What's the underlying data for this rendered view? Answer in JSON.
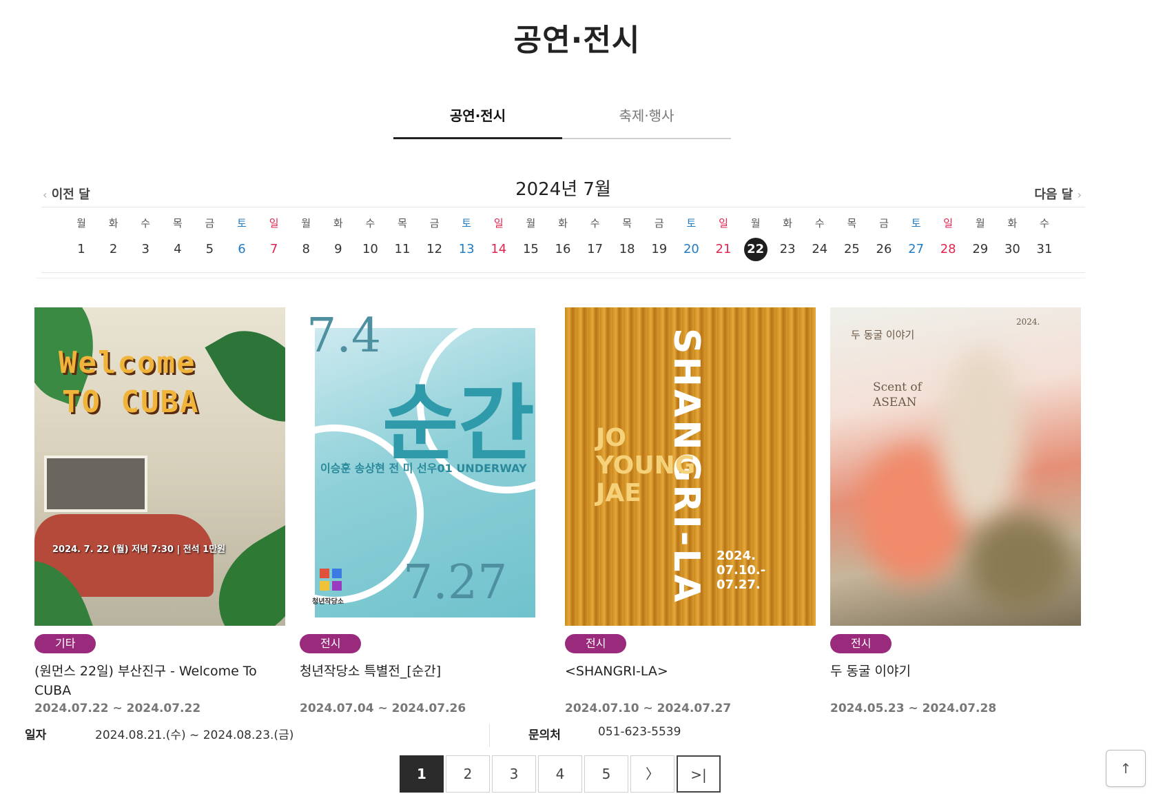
{
  "page": {
    "title": "공연·전시"
  },
  "tabs": [
    {
      "label": "공연·전시",
      "active": true
    },
    {
      "label": "축제·행사",
      "active": false
    }
  ],
  "calendar": {
    "prev_label": "이전 달",
    "next_label": "다음 달",
    "month_label": "2024년 7월",
    "days": [
      {
        "dow": "월",
        "num": "1",
        "type": "weekday"
      },
      {
        "dow": "화",
        "num": "2",
        "type": "weekday"
      },
      {
        "dow": "수",
        "num": "3",
        "type": "weekday"
      },
      {
        "dow": "목",
        "num": "4",
        "type": "weekday"
      },
      {
        "dow": "금",
        "num": "5",
        "type": "weekday"
      },
      {
        "dow": "토",
        "num": "6",
        "type": "sat"
      },
      {
        "dow": "일",
        "num": "7",
        "type": "sun"
      },
      {
        "dow": "월",
        "num": "8",
        "type": "weekday"
      },
      {
        "dow": "화",
        "num": "9",
        "type": "weekday"
      },
      {
        "dow": "수",
        "num": "10",
        "type": "weekday"
      },
      {
        "dow": "목",
        "num": "11",
        "type": "weekday"
      },
      {
        "dow": "금",
        "num": "12",
        "type": "weekday"
      },
      {
        "dow": "토",
        "num": "13",
        "type": "sat"
      },
      {
        "dow": "일",
        "num": "14",
        "type": "sun"
      },
      {
        "dow": "월",
        "num": "15",
        "type": "weekday"
      },
      {
        "dow": "화",
        "num": "16",
        "type": "weekday"
      },
      {
        "dow": "수",
        "num": "17",
        "type": "weekday"
      },
      {
        "dow": "목",
        "num": "18",
        "type": "weekday"
      },
      {
        "dow": "금",
        "num": "19",
        "type": "weekday"
      },
      {
        "dow": "토",
        "num": "20",
        "type": "sat"
      },
      {
        "dow": "일",
        "num": "21",
        "type": "sun"
      },
      {
        "dow": "월",
        "num": "22",
        "type": "today"
      },
      {
        "dow": "화",
        "num": "23",
        "type": "weekday"
      },
      {
        "dow": "수",
        "num": "24",
        "type": "weekday"
      },
      {
        "dow": "목",
        "num": "25",
        "type": "weekday"
      },
      {
        "dow": "금",
        "num": "26",
        "type": "weekday"
      },
      {
        "dow": "토",
        "num": "27",
        "type": "sat"
      },
      {
        "dow": "일",
        "num": "28",
        "type": "sun"
      },
      {
        "dow": "월",
        "num": "29",
        "type": "weekday"
      },
      {
        "dow": "화",
        "num": "30",
        "type": "weekday"
      },
      {
        "dow": "수",
        "num": "31",
        "type": "weekday"
      }
    ]
  },
  "events": [
    {
      "badge": "기타",
      "title": "(원먼스 22일) 부산진구 - Welcome To CUBA",
      "date": "2024.07.22 ~ 2024.07.22",
      "poster": {
        "line1": "Welcome",
        "line2": "TO CUBA",
        "info": "2024. 7. 22 (월) 저녁 7:30 | 전석 1만원"
      }
    },
    {
      "badge": "전시",
      "title": "청년작당소 특별전_[순간]",
      "date": "2024.07.04 ~ 2024.07.26",
      "poster": {
        "date_top": "7.4",
        "big": "순간",
        "names": "이승훈  송상현  전 미  선우01  UNDERWAY",
        "date_bottom": "7.27",
        "logo_label": "청년작당소"
      }
    },
    {
      "badge": "전시",
      "title": "<SHANGRI-LA>",
      "date": "2024.07.10 ~ 2024.07.27",
      "poster": {
        "vertical": "SHANGRI-LA",
        "artist": "JO YOUNG JAE",
        "dates": "2024. 07.10.- 07.27."
      }
    },
    {
      "badge": "전시",
      "title": "두 동굴 이야기",
      "date": "2024.05.23 ~ 2024.07.28",
      "poster": {
        "kr_title": "두 동굴 이야기",
        "en_title": "Scent of ASEAN",
        "year": "2024."
      }
    }
  ],
  "info_row": {
    "date_label": "일자",
    "date_value": "2024.08.21.(수) ~ 2024.08.23.(금)",
    "contact_label": "문의처",
    "contact_value": "051-623-5539"
  },
  "pagination": {
    "pages": [
      "1",
      "2",
      "3",
      "4",
      "5"
    ],
    "active": "1",
    "next": "〉",
    "last": ">|"
  },
  "top_button": {
    "label": "↑"
  },
  "colors": {
    "accent_badge": "#9a2a7c",
    "saturday": "#1f7bc4",
    "sunday": "#e0244d",
    "today_bg": "#1e1e1e"
  }
}
